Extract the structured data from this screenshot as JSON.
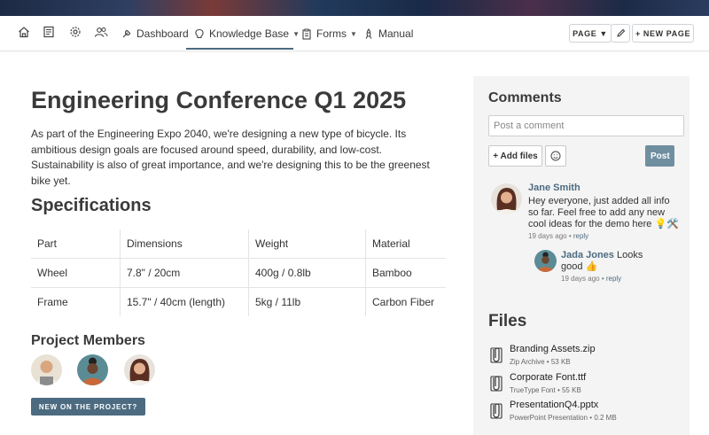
{
  "nav": {
    "items": [
      {
        "label": "Dashboard"
      },
      {
        "label": "Knowledge Base"
      },
      {
        "label": "Forms"
      },
      {
        "label": "Manual"
      }
    ],
    "page_button": "PAGE ▼",
    "new_page_button": "+ NEW PAGE"
  },
  "page": {
    "title": "Engineering Conference Q1 2025",
    "intro": "As part of the Engineering Expo 2040, we're designing a new type of bicycle. Its ambitious design goals are focused around speed, durability, and low-cost. Sustainability is also of great importance, and we're designing this to be the greenest bike yet."
  },
  "specs": {
    "heading": "Specifications",
    "columns": [
      "Part",
      "Dimensions",
      "Weight",
      "Material"
    ],
    "rows": [
      [
        "Wheel",
        "7.8\" / 20cm",
        "400g / 0.8lb",
        "Bamboo"
      ],
      [
        "Frame",
        "15.7\" / 40cm (length)",
        "5kg / 11lb",
        "Carbon Fiber"
      ]
    ]
  },
  "members": {
    "heading": "Project Members",
    "new_button": "NEW ON THE PROJECT?"
  },
  "comments": {
    "heading": "Comments",
    "placeholder": "Post a comment",
    "add_files": "+ Add files",
    "post": "Post",
    "items": [
      {
        "author": "Jane Smith",
        "text": "Hey everyone, just added all info so far. Feel free to add any new cool ideas for the demo here 💡🛠️",
        "time": "19 days ago",
        "reply": "reply"
      },
      {
        "author": "Jada Jones",
        "text": "Looks good 👍",
        "time": "19 days ago",
        "reply": "reply"
      }
    ]
  },
  "files": {
    "heading": "Files",
    "items": [
      {
        "name": "Branding Assets.zip",
        "type": "Zip Archive",
        "size": "53 KB"
      },
      {
        "name": "Corporate Font.ttf",
        "type": "TrueType Font",
        "size": "55 KB"
      },
      {
        "name": "PresentationQ4.pptx",
        "type": "PowerPoint Presentation",
        "size": "0.2 MB"
      }
    ]
  },
  "colors": {
    "accent": "#4c6b80",
    "sidebar_bg": "#f4f4f4",
    "post_button": "#6f8fa0"
  }
}
